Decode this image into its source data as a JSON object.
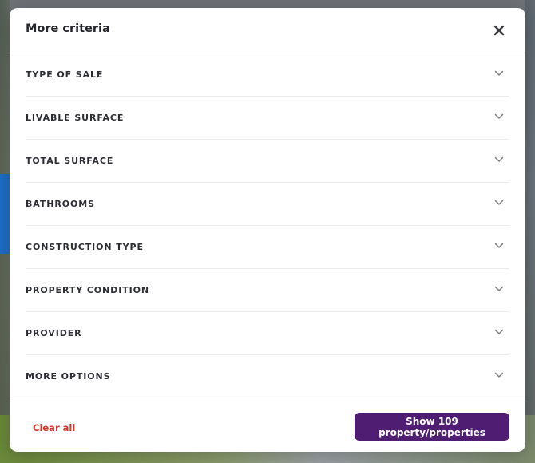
{
  "modal": {
    "title": "More criteria",
    "close_icon": "close-icon"
  },
  "criteria": [
    {
      "label": "TYPE OF SALE"
    },
    {
      "label": "LIVABLE SURFACE"
    },
    {
      "label": "TOTAL SURFACE"
    },
    {
      "label": "BATHROOMS"
    },
    {
      "label": "CONSTRUCTION TYPE"
    },
    {
      "label": "PROPERTY CONDITION"
    },
    {
      "label": "PROVIDER"
    },
    {
      "label": "MORE OPTIONS"
    }
  ],
  "footer": {
    "clear_label": "Clear all",
    "show_label": "Show 109 property/properties"
  },
  "colors": {
    "primary_button": "#4f1d72",
    "clear_link": "#d8352a",
    "title_text": "#25262b"
  }
}
